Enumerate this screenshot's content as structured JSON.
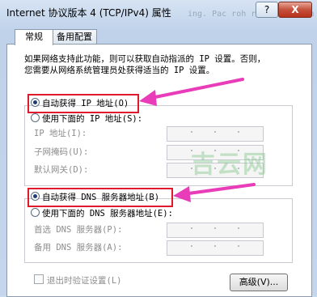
{
  "window": {
    "title": "Internet 协议版本 4 (TCP/IPv4) 属性",
    "title_ghost": "ing.  Pac  roh   ranitor  diton",
    "help_label": "?",
    "close_label": "X"
  },
  "tabs": [
    {
      "label": "常规"
    },
    {
      "label": "备用配置"
    }
  ],
  "description": {
    "line1": "如果网络支持此功能，则可以获取自动指派的 IP 设置。否则，",
    "line2": "您需要从网络系统管理员处获得适当的 IP 设置。"
  },
  "ip_section": {
    "auto_label": "自动获得 IP 地址(O)",
    "manual_label": "使用下面的 IP 地址(S):",
    "fields": [
      {
        "label": "IP 地址(I):"
      },
      {
        "label": "子网掩码(U):"
      },
      {
        "label": "默认网关(D):"
      }
    ]
  },
  "dns_section": {
    "auto_label": "自动获得 DNS 服务器地址(B)",
    "manual_label": "使用下面的 DNS 服务器地址(E):",
    "fields": [
      {
        "label": "首选 DNS 服务器(P):"
      },
      {
        "label": "备用 DNS 服务器(A):"
      }
    ]
  },
  "validate_label": "退出时验证设置(L)",
  "advanced_label": "高级(V)...",
  "watermark": "吉云网",
  "colors": {
    "highlight": "#e01a2c",
    "arrow": "#e83cb8"
  }
}
